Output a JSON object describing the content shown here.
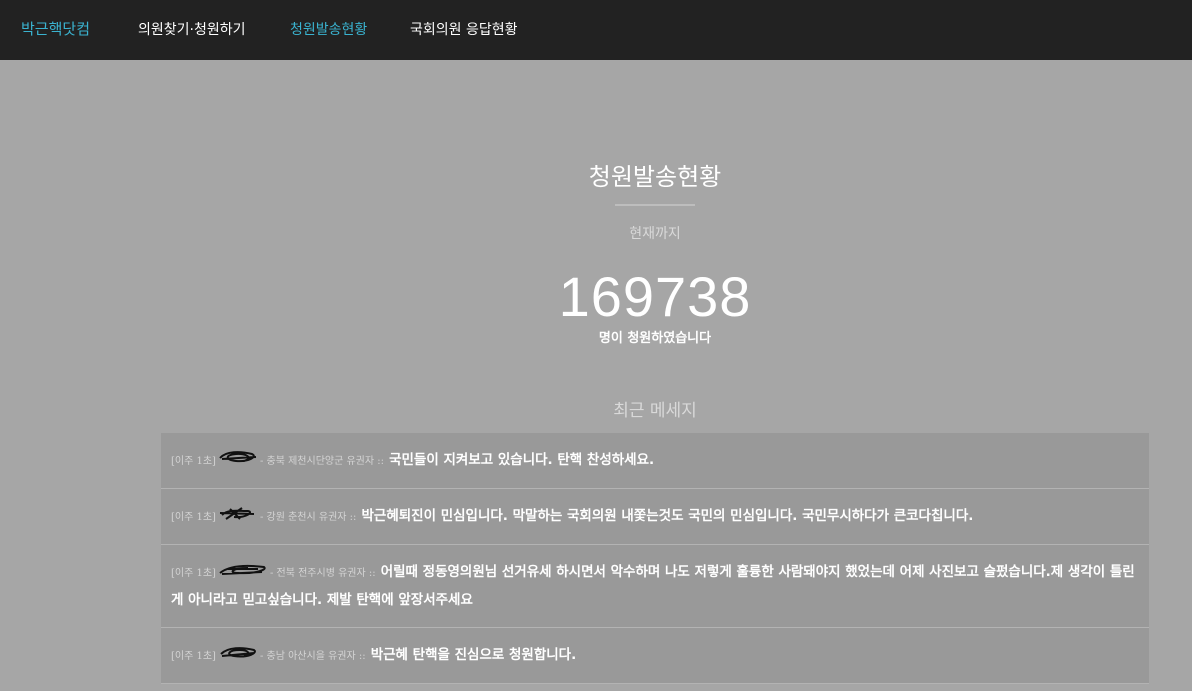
{
  "nav": {
    "brand": "박근핵닷컴",
    "items": [
      {
        "label": "의원찾기·청원하기"
      },
      {
        "label": "청원발송현황"
      },
      {
        "label": "국회의원 응답현황"
      }
    ],
    "active_color": "#3ab3d0"
  },
  "hero": {
    "title": "청원발송현황",
    "subtitle": "현재까지",
    "count": "169738",
    "caption": "명이 청원하였습니다"
  },
  "messages": {
    "heading": "최근 메세지",
    "items": [
      {
        "time": "[이주 1초]",
        "region": "- 충북 제천시단양군 유권자 ::",
        "text": "국민들이 지켜보고 있습니다. 탄핵 찬성하세요."
      },
      {
        "time": "[이주 1초]",
        "region": "- 강원 춘천시 유권자 ::",
        "text": "박근혜퇴진이 민심입니다. 막말하는 국회의원 내쫓는것도 국민의 민심입니다. 국민무시하다가 큰코다칩니다."
      },
      {
        "time": "[이주 1초]",
        "region": "- 전북 전주시병 유권자 ::",
        "text": "어릴때 정동영의원님 선거유세 하시면서 악수하며 나도 저렇게 훌륭한 사람돼야지 했었는데 어제 사진보고 슬펐습니다.제 생각이 틀린게 아니라고 믿고싶습니다. 제발 탄핵에 앞장서주세요"
      },
      {
        "time": "[이주 1초]",
        "region": "- 충남 아산시을 유권자 ::",
        "text": "박근혜 탄핵을 진심으로 청원합니다."
      }
    ]
  }
}
